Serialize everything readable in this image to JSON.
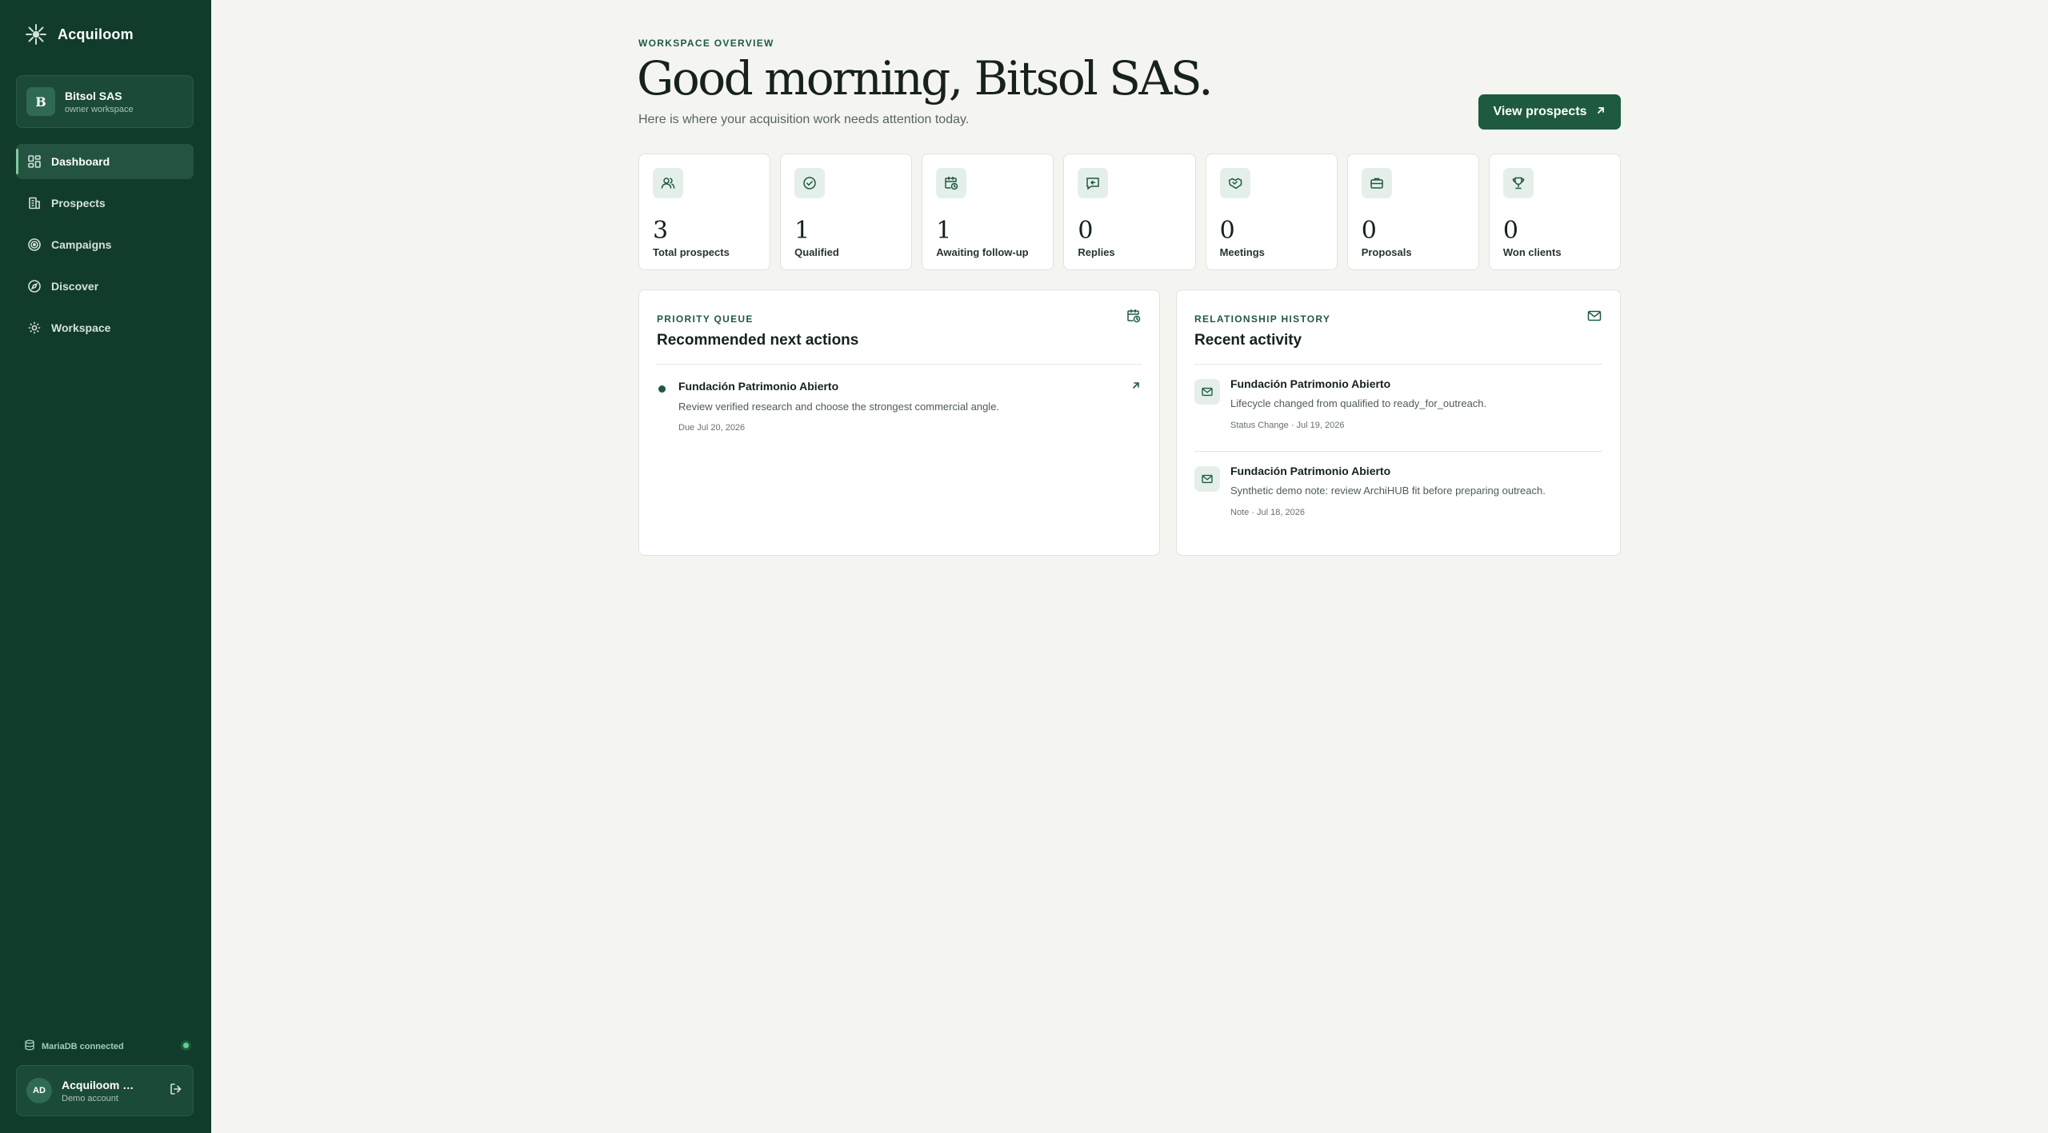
{
  "brand": {
    "name": "Acquiloom"
  },
  "workspace": {
    "initial": "B",
    "name": "Bitsol SAS",
    "role": "owner workspace"
  },
  "nav": {
    "items": [
      {
        "label": "Dashboard",
        "icon": "grid-icon",
        "active": true
      },
      {
        "label": "Prospects",
        "icon": "building-icon",
        "active": false
      },
      {
        "label": "Campaigns",
        "icon": "target-icon",
        "active": false
      },
      {
        "label": "Discover",
        "icon": "compass-icon",
        "active": false
      },
      {
        "label": "Workspace",
        "icon": "gear-icon",
        "active": false
      }
    ]
  },
  "db_status": {
    "label": "MariaDB connected",
    "color": "#5fd08f"
  },
  "account": {
    "initials": "AD",
    "name": "Acquiloom Demo",
    "sub": "Demo account"
  },
  "header": {
    "eyebrow": "WORKSPACE OVERVIEW",
    "title": "Good morning, Bitsol SAS.",
    "subtitle": "Here is where your acquisition work needs attention today.",
    "cta_label": "View prospects"
  },
  "stats": [
    {
      "value": "3",
      "label": "Total prospects",
      "icon": "users-icon"
    },
    {
      "value": "1",
      "label": "Qualified",
      "icon": "check-circle-icon"
    },
    {
      "value": "1",
      "label": "Awaiting follow-up",
      "icon": "calendar-clock-icon"
    },
    {
      "value": "0",
      "label": "Replies",
      "icon": "message-reply-icon"
    },
    {
      "value": "0",
      "label": "Meetings",
      "icon": "handshake-icon"
    },
    {
      "value": "0",
      "label": "Proposals",
      "icon": "briefcase-icon"
    },
    {
      "value": "0",
      "label": "Won clients",
      "icon": "trophy-icon"
    }
  ],
  "priority_queue": {
    "eyebrow": "PRIORITY QUEUE",
    "title": "Recommended next actions",
    "items": [
      {
        "name": "Fundación Patrimonio Abierto",
        "description": "Review verified research and choose the strongest commercial angle.",
        "due": "Due Jul 20, 2026"
      }
    ]
  },
  "relationship_history": {
    "eyebrow": "RELATIONSHIP HISTORY",
    "title": "Recent activity",
    "items": [
      {
        "name": "Fundación Patrimonio Abierto",
        "description": "Lifecycle changed from qualified to ready_for_outreach.",
        "meta": "Status Change · Jul 19, 2026"
      },
      {
        "name": "Fundación Patrimonio Abierto",
        "description": "Synthetic demo note: review ArchiHUB fit before preparing outreach.",
        "meta": "Note · Jul 18, 2026"
      }
    ]
  },
  "colors": {
    "sidebar": "#113b2b",
    "accent": "#1d5a40",
    "background": "#f4f5f1"
  }
}
